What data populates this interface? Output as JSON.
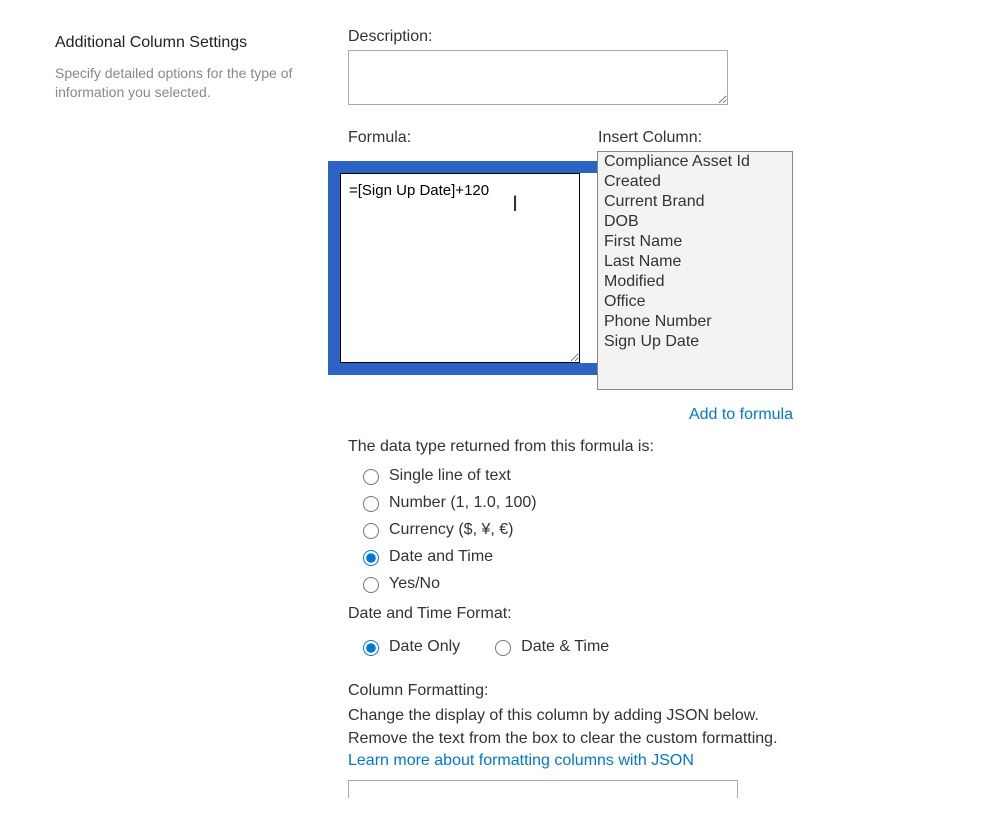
{
  "left": {
    "heading": "Additional Column Settings",
    "description": "Specify detailed options for the type of information you selected."
  },
  "description": {
    "label": "Description:",
    "value": ""
  },
  "formula": {
    "label": "Formula:",
    "value": "=[Sign Up Date]+120"
  },
  "insert_column": {
    "label": "Insert Column:",
    "options": [
      "Compliance Asset Id",
      "Created",
      "Current Brand",
      "DOB",
      "First Name",
      "Last Name",
      "Modified",
      "Office",
      "Phone Number",
      "Sign Up Date"
    ],
    "add_link": "Add to formula"
  },
  "data_type": {
    "label": "The data type returned from this formula is:",
    "options": [
      "Single line of text",
      "Number (1, 1.0, 100)",
      "Currency ($, ¥, €)",
      "Date and Time",
      "Yes/No"
    ],
    "selected": "Date and Time"
  },
  "datetime_format": {
    "label": "Date and Time Format:",
    "options": [
      "Date Only",
      "Date & Time"
    ],
    "selected": "Date Only"
  },
  "column_formatting": {
    "label": "Column Formatting:",
    "desc1": "Change the display of this column by adding JSON below.",
    "desc2": "Remove the text from the box to clear the custom formatting.",
    "link": "Learn more about formatting columns with JSON"
  }
}
